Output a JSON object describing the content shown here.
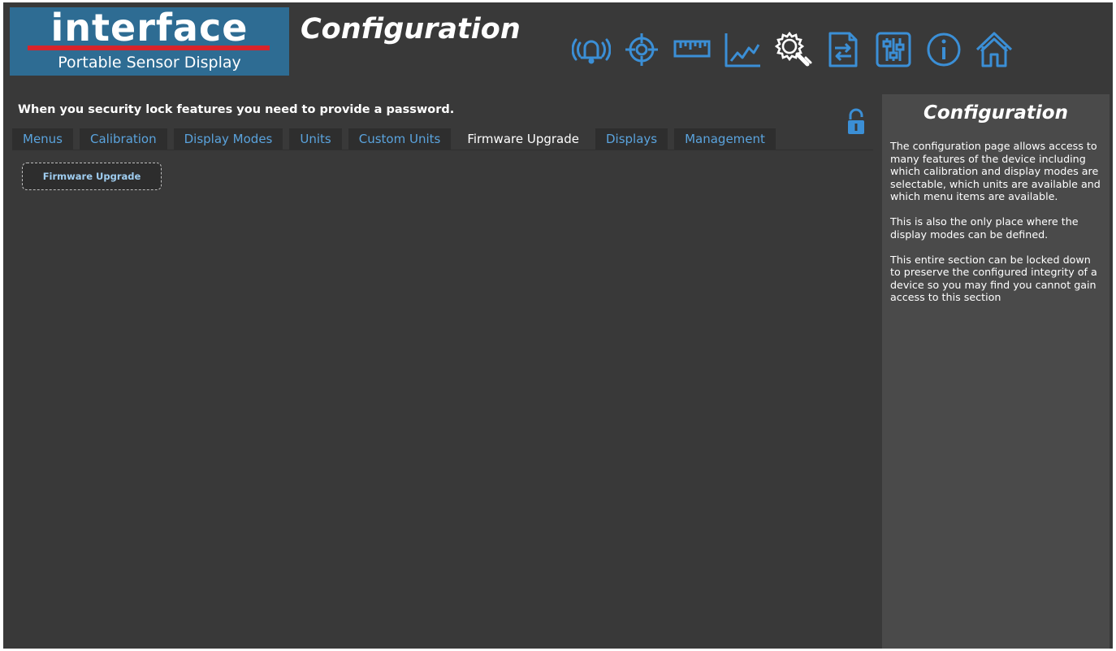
{
  "brand": {
    "name": "interface",
    "subtitle": "Portable Sensor Display",
    "bar_color": "#d9232a",
    "bg_color": "#2e6c93"
  },
  "header": {
    "title": "Configuration"
  },
  "toolbar": {
    "icons": [
      {
        "name": "alarm-icon",
        "color": "#3b8fd6"
      },
      {
        "name": "target-icon",
        "color": "#3b8fd6"
      },
      {
        "name": "ruler-icon",
        "color": "#3b8fd6"
      },
      {
        "name": "chart-icon",
        "color": "#3b8fd6"
      },
      {
        "name": "settings-wrench-icon",
        "color": "#ffffff"
      },
      {
        "name": "file-transfer-icon",
        "color": "#3b8fd6"
      },
      {
        "name": "sliders-icon",
        "color": "#3b8fd6"
      },
      {
        "name": "info-icon",
        "color": "#3b8fd6"
      },
      {
        "name": "home-icon",
        "color": "#3b8fd6"
      }
    ]
  },
  "main": {
    "instruction": "When you security lock features you need to provide a password.",
    "lock_state": "unlocked",
    "tabs": [
      {
        "label": "Menus",
        "active": false
      },
      {
        "label": "Calibration",
        "active": false
      },
      {
        "label": "Display Modes",
        "active": false
      },
      {
        "label": "Units",
        "active": false
      },
      {
        "label": "Custom Units",
        "active": false
      },
      {
        "label": "Firmware Upgrade",
        "active": true
      },
      {
        "label": "Displays",
        "active": false
      },
      {
        "label": "Management",
        "active": false
      }
    ],
    "panel": {
      "button_label": "Firmware Upgrade"
    }
  },
  "help": {
    "title": "Configuration",
    "paragraphs": [
      "The configuration page allows access to many features of the device including which calibration and display modes are selectable, which units are available and which menu items are available.",
      "This is also the only place where the display modes can be defined.",
      "This entire section can be locked down to preserve the configured integrity of a device so you may find you cannot gain access to this section"
    ]
  },
  "colors": {
    "accent": "#3b8fd6",
    "tab_text": "#5aa3dd",
    "background": "#393939",
    "help_background": "#4a4a4a"
  }
}
